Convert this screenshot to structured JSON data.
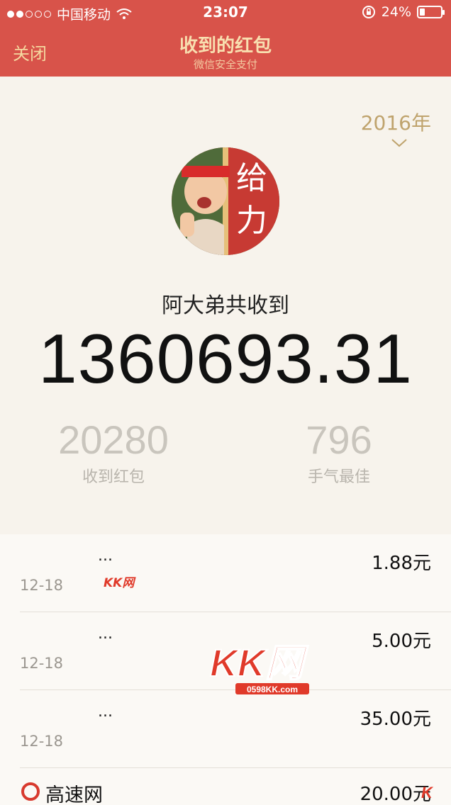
{
  "status_bar": {
    "carrier": "中国移动",
    "time": "23:07",
    "battery_text": "24%",
    "battery_level": 0.24,
    "signal_bars_filled": 2,
    "signal_bars_total": 5
  },
  "nav": {
    "close_label": "关闭",
    "title": "收到的红包",
    "subtitle": "微信安全支付"
  },
  "year": {
    "label": "2016年"
  },
  "avatar": {
    "text": "给力"
  },
  "summary": {
    "label": "阿大弟共收到",
    "total": "1360693.31"
  },
  "stats": {
    "received": {
      "value": "20280",
      "label": "收到红包"
    },
    "best": {
      "value": "796",
      "label": "手气最佳"
    }
  },
  "list": {
    "items": [
      {
        "name": "...",
        "date": "12-18",
        "amount": "1.88元"
      },
      {
        "name": "...",
        "date": "12-18",
        "amount": "5.00元"
      },
      {
        "name": "...",
        "date": "12-18",
        "amount": "35.00元"
      }
    ],
    "last_item": {
      "name": "高速网",
      "amount": "20.00元"
    }
  },
  "watermarks": {
    "small": "KK网",
    "big_domain": "0598KK.com"
  },
  "colors": {
    "header_red": "#d8534a",
    "gold": "#bfa36d",
    "background": "#f7f3ec"
  }
}
